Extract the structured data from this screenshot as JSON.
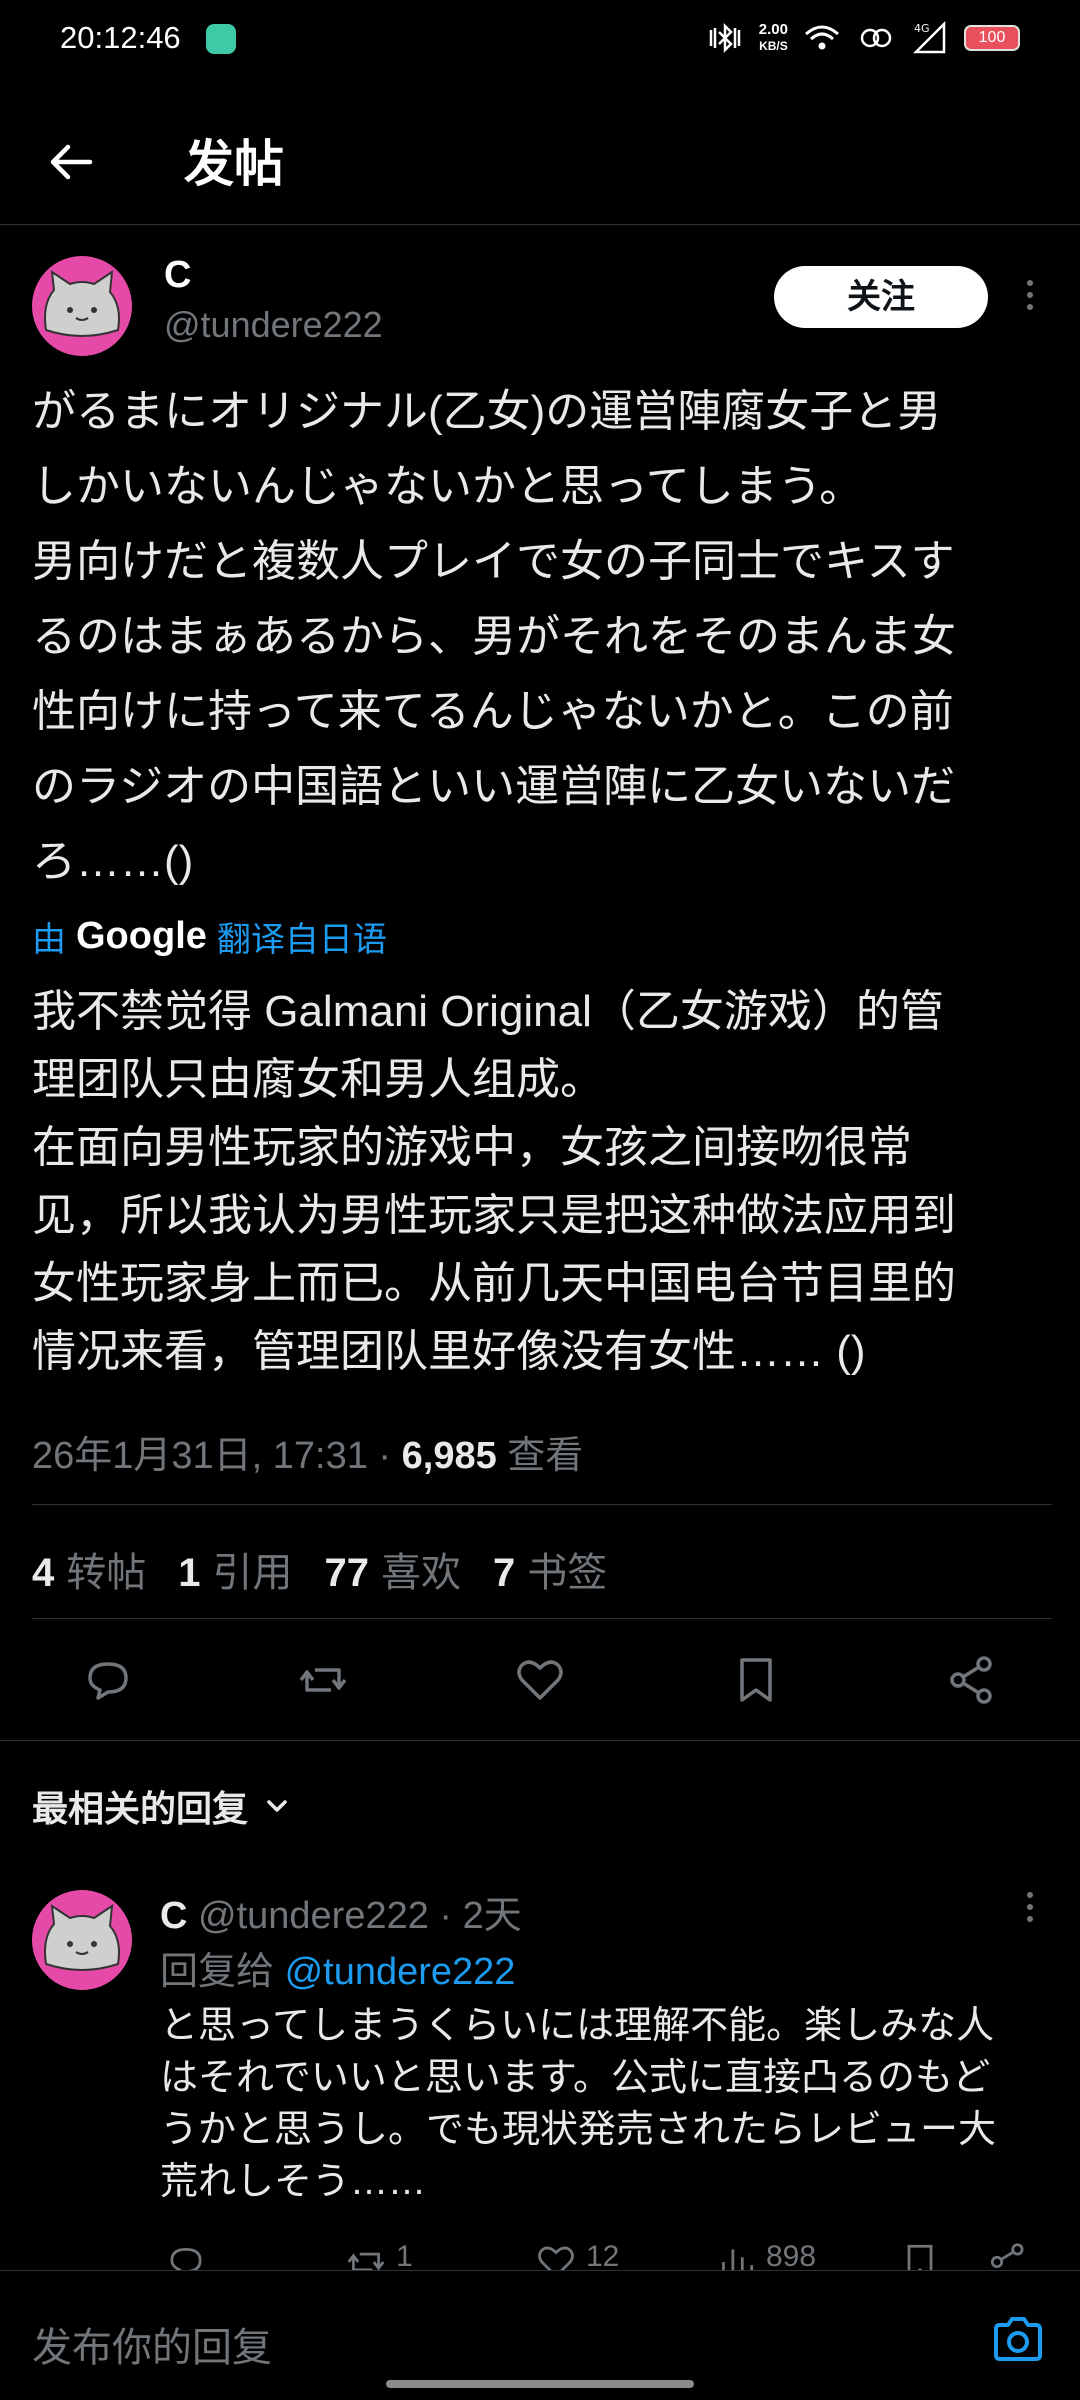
{
  "status_bar": {
    "time": "20:12:46",
    "net_speed_value": "2.00",
    "net_speed_unit": "KB/S",
    "signal_label": "4G",
    "battery": "100"
  },
  "header": {
    "title": "发帖"
  },
  "post": {
    "author_name": "C",
    "author_handle": "@tundere222",
    "follow_label": "关注",
    "original_text": "がるまにオリジナル(乙女)の運営陣腐女子と男\nしかいないんじゃないかと思ってしまう。\n男向けだと複数人プレイで女の子同士でキスす\nるのはまぁあるから、男がそれをそのまんま女\n性向けに持って来てるんじゃないかと。この前\nのラジオの中国語といい運営陣に乙女いないだ\nろ……()",
    "translation_prefix": "由",
    "translation_provider": "Google",
    "translation_suffix": "翻译自日语",
    "translated_text": "我不禁觉得 Galmani Original（乙女游戏）的管\n理团队只由腐女和男人组成。\n在面向男性玩家的游戏中，女孩之间接吻很常\n见，所以我认为男性玩家只是把这种做法应用到\n女性玩家身上而已。从前几天中国电台节目里的\n情况来看，管理团队里好像没有女性…… ()",
    "timestamp": "26年1月31日, 17:31 · ",
    "views_count": "6,985",
    "views_label": " 查看",
    "stats": {
      "reposts_count": "4",
      "reposts_label": "转帖",
      "quotes_count": "1",
      "quotes_label": "引用",
      "likes_count": "77",
      "likes_label": "喜欢",
      "bookmarks_count": "7",
      "bookmarks_label": "书签"
    },
    "action_icons": [
      "reply-icon",
      "repost-icon",
      "like-icon",
      "bookmark-icon",
      "share-icon"
    ]
  },
  "replies_section": {
    "sort_label": "最相关的回复"
  },
  "reply": {
    "author_name": "C",
    "meta": " @tundere222 · 2天",
    "reply_to_prefix": "回复给 ",
    "reply_to_handle": "@tundere222",
    "text": "と思ってしまうくらいには理解不能。楽しみな人\nはそれでいいと思います。公式に直接凸るのもど\nうかと思うし。でも現状発売されたらレビュー大\n荒れしそう……",
    "reposts_count": "1",
    "likes_count": "12",
    "views_count": "898"
  },
  "compose": {
    "placeholder": "发布你的回复"
  },
  "colors": {
    "accent": "#1d9bf0",
    "avatar_bg": "#e64aa8",
    "background": "#000000"
  }
}
